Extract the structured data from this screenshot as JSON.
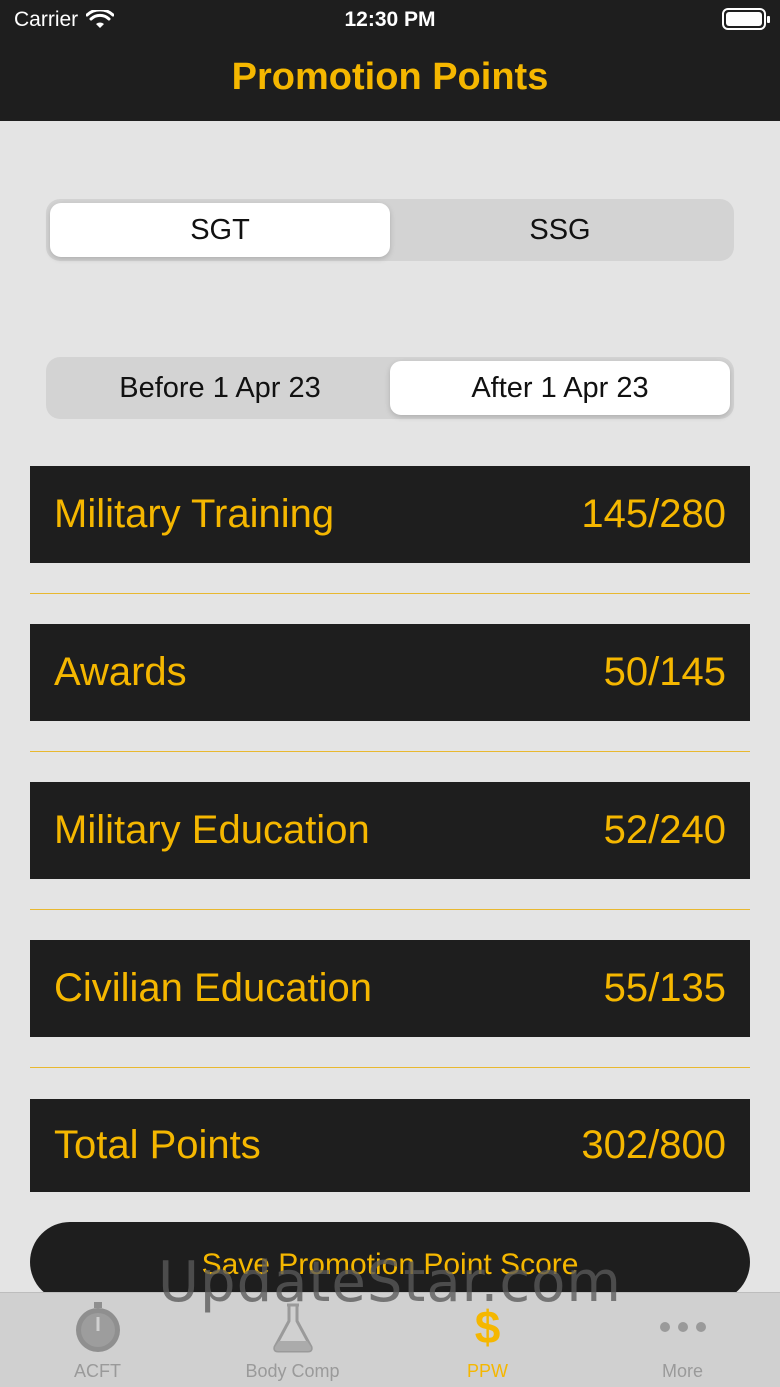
{
  "status": {
    "carrier": "Carrier",
    "time": "12:30 PM"
  },
  "nav": {
    "title": "Promotion Points"
  },
  "rank_segment": {
    "options": [
      "SGT",
      "SSG"
    ],
    "selected": "SGT"
  },
  "date_segment": {
    "options": [
      "Before 1 Apr 23",
      "After 1 Apr 23"
    ],
    "selected": "After 1 Apr 23"
  },
  "rows": [
    {
      "label": "Military Training",
      "value": "145/280"
    },
    {
      "label": "Awards",
      "value": "50/145"
    },
    {
      "label": "Military Education",
      "value": "52/240"
    },
    {
      "label": "Civilian Education",
      "value": "55/135"
    },
    {
      "label": "Total Points",
      "value": "302/800"
    }
  ],
  "save_button": {
    "label": "Save Promotion Point Score"
  },
  "tabs": [
    {
      "label": "ACFT",
      "icon": "stopwatch-icon"
    },
    {
      "label": "Body Comp",
      "icon": "flask-icon"
    },
    {
      "label": "PPW",
      "icon": "dollar-icon",
      "active": true
    },
    {
      "label": "More",
      "icon": "more-dots-icon"
    }
  ],
  "watermark": "UpdateStar.com",
  "colors": {
    "accent": "#f5b700",
    "dark": "#1e1e1e",
    "background": "#e4e4e4"
  }
}
